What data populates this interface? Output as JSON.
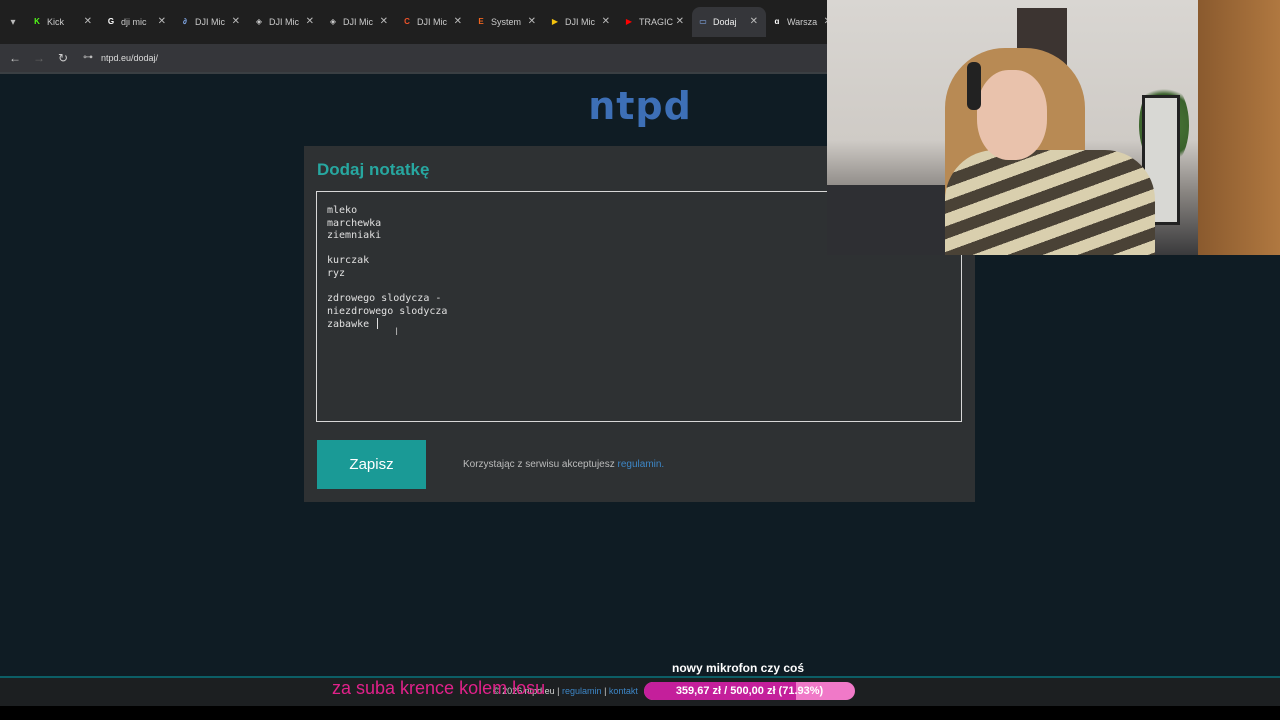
{
  "browser": {
    "tabs": [
      {
        "label": "Kick",
        "icon": "kick-icon",
        "color": "#53fc18",
        "glyph": "K"
      },
      {
        "label": "dji mic",
        "icon": "google-icon",
        "color": "#ffffff",
        "glyph": "G"
      },
      {
        "label": "DJI Mic",
        "icon": "link-icon",
        "color": "#8ab4f8",
        "glyph": "∂"
      },
      {
        "label": "DJI Mic",
        "icon": "dji-icon",
        "color": "#cccccc",
        "glyph": "◈"
      },
      {
        "label": "DJI Mic",
        "icon": "dji-icon",
        "color": "#cccccc",
        "glyph": "◈"
      },
      {
        "label": "DJI Mic",
        "icon": "ceneo-icon",
        "color": "#f0532a",
        "glyph": "C"
      },
      {
        "label": "System",
        "icon": "etsy-icon",
        "color": "#f1641e",
        "glyph": "E"
      },
      {
        "label": "DJI Mic",
        "icon": "play-icon",
        "color": "#f4c20d",
        "glyph": "▶"
      },
      {
        "label": "TRAGIC",
        "icon": "youtube-icon",
        "color": "#ff0000",
        "glyph": "▶"
      },
      {
        "label": "Dodaj",
        "icon": "ntpd-icon",
        "color": "#8ab4f8",
        "glyph": "▭",
        "active": true
      },
      {
        "label": "Warsza",
        "icon": "booking-icon",
        "color": "#ffffff",
        "glyph": "ɑ"
      }
    ],
    "url": "ntpd.eu/dodaj/"
  },
  "page": {
    "logo": "ntpd",
    "title": "Dodaj notatkę",
    "note_lines": [
      "mleko",
      "marchewka",
      "ziemniaki",
      "",
      "kurczak",
      "ryz",
      "",
      "zdrowego slodycza -",
      "niezdrowego slodycza",
      "zabawke "
    ],
    "save_label": "Zapisz",
    "terms_text": "Korzystając z serwisu akceptujesz ",
    "terms_link": "regulamin."
  },
  "stream": {
    "goal_title": "nowy mikrofon czy coś",
    "goal_text": "359,67 zł / 500,00 zł (71.93%)",
    "goal_fraction": 0.7193,
    "footer_text": "© 2026 ntpd.eu | ",
    "footer_link1": "regulamin",
    "footer_sep": " | ",
    "footer_link2": "kontakt",
    "spin_text": "za suba krence kolem losu"
  }
}
